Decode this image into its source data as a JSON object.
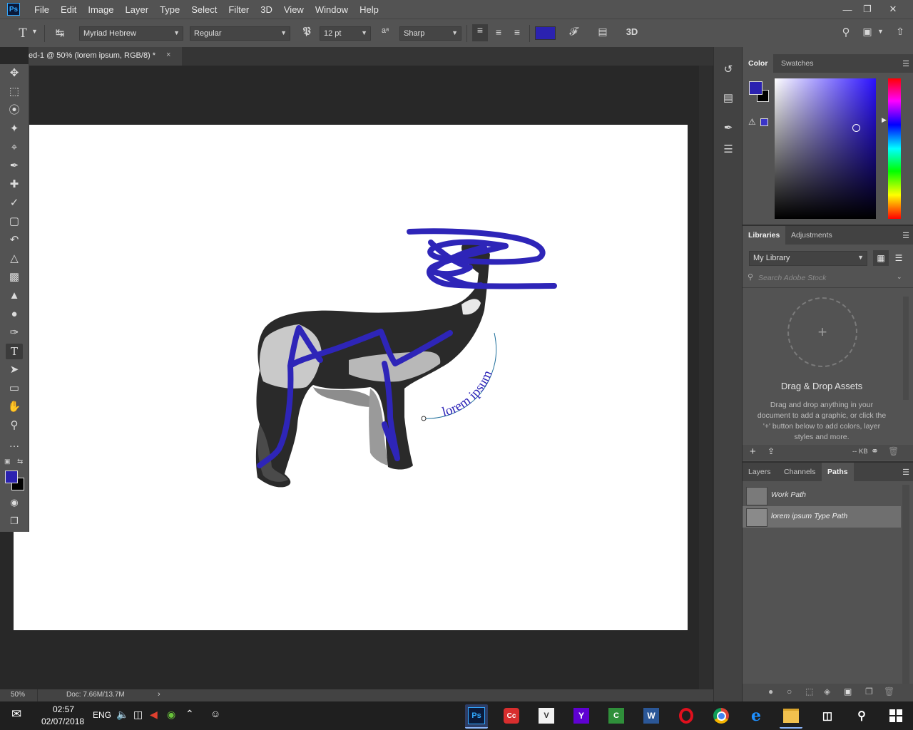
{
  "menubar": {
    "app_icon": "Ps",
    "items": [
      "File",
      "Edit",
      "Image",
      "Layer",
      "Type",
      "Select",
      "Filter",
      "3D",
      "View",
      "Window",
      "Help"
    ]
  },
  "options_bar": {
    "tool_icon": "type-tool-icon",
    "font_family": "Myriad Hebrew",
    "font_style": "Regular",
    "font_size": "12 pt",
    "antialias": "Sharp",
    "text_color": "#2b22b0",
    "3d_label": "3D"
  },
  "document_tab": {
    "title": "ed-1 @ 50% (lorem ipsum, RGB/8) *",
    "close": "×"
  },
  "canvas": {
    "path_text": "lorem ipsum",
    "stroke_color": "#2e25b8"
  },
  "status_bar": {
    "zoom": "50%",
    "doc_size": "Doc: 7.66M/13.7M"
  },
  "color_panel": {
    "tabs": [
      "Color",
      "Swatches"
    ],
    "foreground": "#2b22b0",
    "background": "#000000"
  },
  "libraries_panel": {
    "tabs": [
      "Libraries",
      "Adjustments"
    ],
    "library_select": "My Library",
    "search_placeholder": "Search Adobe Stock",
    "drop_title": "Drag & Drop Assets",
    "drop_text": "Drag and drop anything in your document to add a graphic, or click the '+' button below to add colors, layer styles and more.",
    "storage": "-- KB"
  },
  "paths_panel": {
    "tabs": [
      "Layers",
      "Channels",
      "Paths"
    ],
    "paths": [
      {
        "name": "Work Path",
        "selected": false
      },
      {
        "name": "lorem ipsum Type Path",
        "selected": true
      }
    ]
  },
  "taskbar": {
    "time": "02:57",
    "date": "02/07/2018",
    "lang": "ENG",
    "apps": [
      {
        "name": "photoshop",
        "label": "Ps"
      },
      {
        "name": "creative-cloud",
        "label": "Cc"
      },
      {
        "name": "vpn",
        "label": "V"
      },
      {
        "name": "yahoo",
        "label": "Y"
      },
      {
        "name": "ccleaner",
        "label": "C"
      },
      {
        "name": "word",
        "label": "W"
      },
      {
        "name": "opera",
        "label": "O"
      },
      {
        "name": "chrome",
        "label": ""
      },
      {
        "name": "edge",
        "label": "e"
      },
      {
        "name": "file-explorer",
        "label": ""
      },
      {
        "name": "task-view",
        "label": ""
      },
      {
        "name": "search",
        "label": ""
      },
      {
        "name": "start",
        "label": ""
      }
    ]
  }
}
